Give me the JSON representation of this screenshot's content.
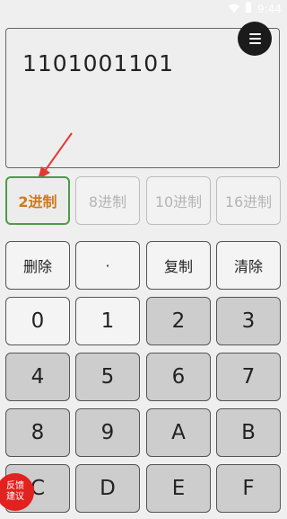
{
  "status": {
    "time": "9:44"
  },
  "display": {
    "value": "1101001101"
  },
  "bases": [
    {
      "label": "2进制"
    },
    {
      "label": "8进制"
    },
    {
      "label": "10进制"
    },
    {
      "label": "16进制"
    }
  ],
  "functions": {
    "delete": "删除",
    "dot": "·",
    "copy": "复制",
    "clear": "清除"
  },
  "keys": [
    "0",
    "1",
    "2",
    "3",
    "4",
    "5",
    "6",
    "7",
    "8",
    "9",
    "A",
    "B",
    "C",
    "D",
    "E",
    "F"
  ],
  "feedback": {
    "line1": "反馈",
    "line2": "建议"
  },
  "colors": {
    "active_text": "#cf7b1a",
    "active_border": "#4f9b47",
    "arrow": "#e53935",
    "feedback_bg": "#e1221f"
  }
}
